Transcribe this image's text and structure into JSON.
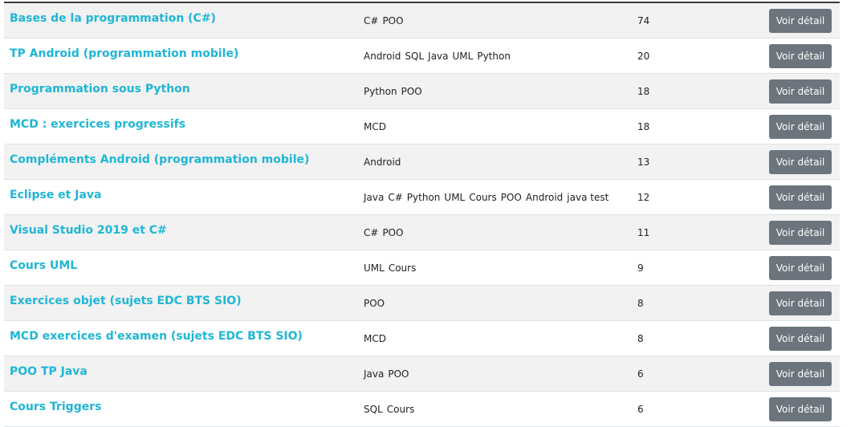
{
  "courses": [
    {
      "title": "Bases de la programmation (C#)",
      "tags": [
        "C#",
        "POO"
      ],
      "count": "74",
      "button": "Voir détail"
    },
    {
      "title": "TP Android (programmation mobile)",
      "tags": [
        "Android",
        "SQL",
        "Java",
        "UML",
        "Python"
      ],
      "count": "20",
      "button": "Voir détail"
    },
    {
      "title": "Programmation sous Python",
      "tags": [
        "Python",
        "POO"
      ],
      "count": "18",
      "button": "Voir détail"
    },
    {
      "title": "MCD : exercices progressifs",
      "tags": [
        "MCD"
      ],
      "count": "18",
      "button": "Voir détail"
    },
    {
      "title": "Compléments Android (programmation mobile)",
      "tags": [
        "Android"
      ],
      "count": "13",
      "button": "Voir détail"
    },
    {
      "title": "Eclipse et Java",
      "tags": [
        "Java",
        "C#",
        "Python",
        "UML",
        "Cours",
        "POO",
        "Android",
        "java test"
      ],
      "count": "12",
      "button": "Voir détail"
    },
    {
      "title": "Visual Studio 2019 et C#",
      "tags": [
        "C#",
        "POO"
      ],
      "count": "11",
      "button": "Voir détail"
    },
    {
      "title": "Cours UML",
      "tags": [
        "UML",
        "Cours"
      ],
      "count": "9",
      "button": "Voir détail"
    },
    {
      "title": "Exercices objet (sujets EDC BTS SIO)",
      "tags": [
        "POO"
      ],
      "count": "8",
      "button": "Voir détail"
    },
    {
      "title": "MCD exercices d'examen (sujets EDC BTS SIO)",
      "tags": [
        "MCD"
      ],
      "count": "8",
      "button": "Voir détail"
    },
    {
      "title": "POO TP Java",
      "tags": [
        "Java",
        "POO"
      ],
      "count": "6",
      "button": "Voir détail"
    },
    {
      "title": "Cours Triggers",
      "tags": [
        "SQL",
        "Cours"
      ],
      "count": "6",
      "button": "Voir détail"
    }
  ],
  "colors": {
    "title_link": "#1fb6d6",
    "button_bg": "#6c757d",
    "stripe_bg": "#f2f2f2"
  }
}
